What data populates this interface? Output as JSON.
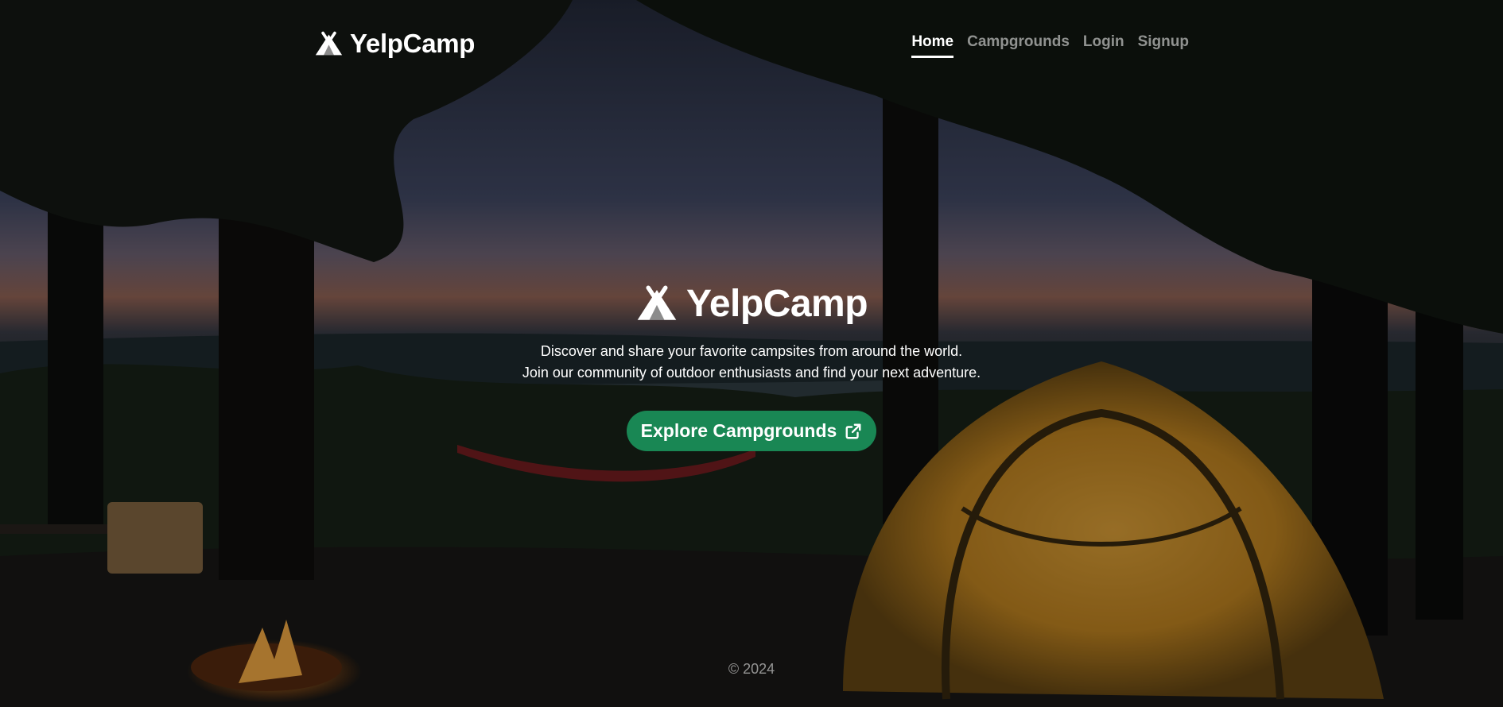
{
  "nav": {
    "brand": "YelpCamp",
    "links": [
      {
        "label": "Home",
        "active": true
      },
      {
        "label": "Campgrounds",
        "active": false
      },
      {
        "label": "Login",
        "active": false
      },
      {
        "label": "Signup",
        "active": false
      }
    ]
  },
  "hero": {
    "title": "YelpCamp",
    "line1": "Discover and share your favorite campsites from around the world.",
    "line2": "Join our community of outdoor enthusiasts and find your next adventure.",
    "cta_label": "Explore Campgrounds"
  },
  "footer": {
    "text": "© 2024"
  },
  "colors": {
    "accent": "#198754",
    "text": "#ffffff"
  },
  "icons": {
    "brand": "campground-icon",
    "cta": "external-link-icon"
  }
}
